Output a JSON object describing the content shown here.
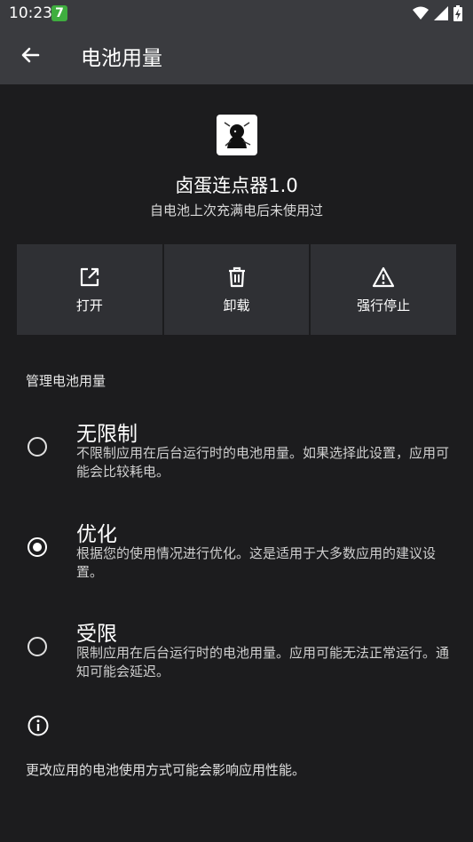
{
  "status_bar": {
    "time": "10:23",
    "notification_badge": "7",
    "icons": [
      "wifi-icon",
      "signal-icon",
      "battery-charging-icon"
    ]
  },
  "app_bar": {
    "back_icon": "arrow-left-icon",
    "title": "电池用量"
  },
  "app_info": {
    "icon": "app-icon",
    "name": "卤蛋连点器1.0",
    "subtitle": "自电池上次充满电后未使用过"
  },
  "actions": [
    {
      "label": "打开",
      "icon": "open-external-icon"
    },
    {
      "label": "卸载",
      "icon": "trash-icon"
    },
    {
      "label": "强行停止",
      "icon": "warning-triangle-icon"
    }
  ],
  "section_title": "管理电池用量",
  "options": [
    {
      "title": "无限制",
      "description": "不限制应用在后台运行时的电池用量。如果选择此设置，应用可能会比较耗电。",
      "selected": false
    },
    {
      "title": "优化",
      "description": "根据您的使用情况进行优化。这是适用于大多数应用的建议设置。",
      "selected": true
    },
    {
      "title": "受限",
      "description": "限制应用在后台运行时的电池用量。应用可能无法正常运行。通知可能会延迟。",
      "selected": false
    }
  ],
  "footer": {
    "icon": "info-icon",
    "text": "更改应用的电池使用方式可能会影响应用性能。"
  }
}
